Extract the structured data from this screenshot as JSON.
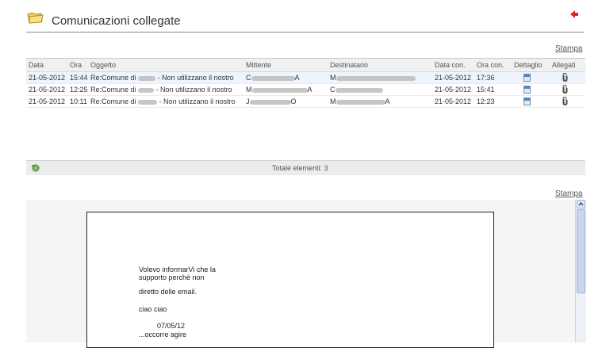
{
  "header": {
    "title": "Comunicazioni collegate"
  },
  "toolbar": {
    "print_label": "Stampa",
    "print_label_2": "Stampa"
  },
  "grid": {
    "columns": [
      "Data",
      "Ora",
      "Oggetto",
      "Mittente",
      "Destinatario",
      "Data con.",
      "Ora con.",
      "Dettaglio",
      "Allegati"
    ],
    "rows": [
      {
        "data": "21-05-2012",
        "ora": "15:44",
        "oggetto_a": "Re:Comune di",
        "oggetto_b": "- Non utilizzano il nostro",
        "mittente": "C",
        "mittente_end": "A",
        "destinatario": "M",
        "data_con": "21-05-2012",
        "ora_con": "17:36"
      },
      {
        "data": "21-05-2012",
        "ora": "12:25",
        "oggetto_a": "Re:Comune di",
        "oggetto_b": "- Non utilizzano il nostro",
        "mittente": "M",
        "mittente_end": "A",
        "destinatario": "C",
        "data_con": "21-05-2012",
        "ora_con": "15:41"
      },
      {
        "data": "21-05-2012",
        "ora": "10:11",
        "oggetto_a": "Re:Comune di",
        "oggetto_b": "- Non utilizzano il nostro",
        "mittente": "J",
        "mittente_end": "O",
        "destinatario": "M",
        "destinatario_end": "A",
        "data_con": "21-05-2012",
        "ora_con": "12:23"
      }
    ],
    "footer": {
      "total": "Totale elementi: 3"
    }
  },
  "preview": {
    "lines": [
      "Volevo informarVi che la",
      "supporto perchè non",
      "diretto delle email.",
      "ciao ciao",
      "07/05/12",
      "...occorre agire"
    ]
  }
}
